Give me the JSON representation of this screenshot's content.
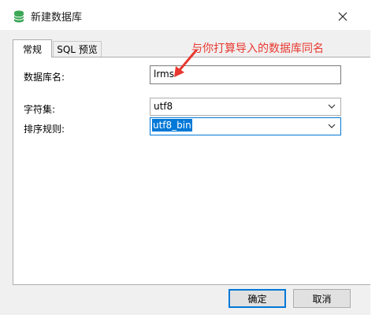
{
  "window": {
    "title": "新建数据库"
  },
  "tabs": [
    {
      "label": "常规"
    },
    {
      "label": "SQL 预览"
    }
  ],
  "form": {
    "db_name_label": "数据库名:",
    "db_name_value": "lrms",
    "charset_label": "字符集:",
    "charset_value": "utf8",
    "collation_label": "排序规则:",
    "collation_value": "utf8_bin"
  },
  "annotation": {
    "text": "与你打算导入的数据库同名",
    "color": "#e8382f"
  },
  "buttons": {
    "ok": "确定",
    "cancel": "取消"
  },
  "colors": {
    "accent": "#0078d7",
    "db_icon": "#3aa655"
  }
}
